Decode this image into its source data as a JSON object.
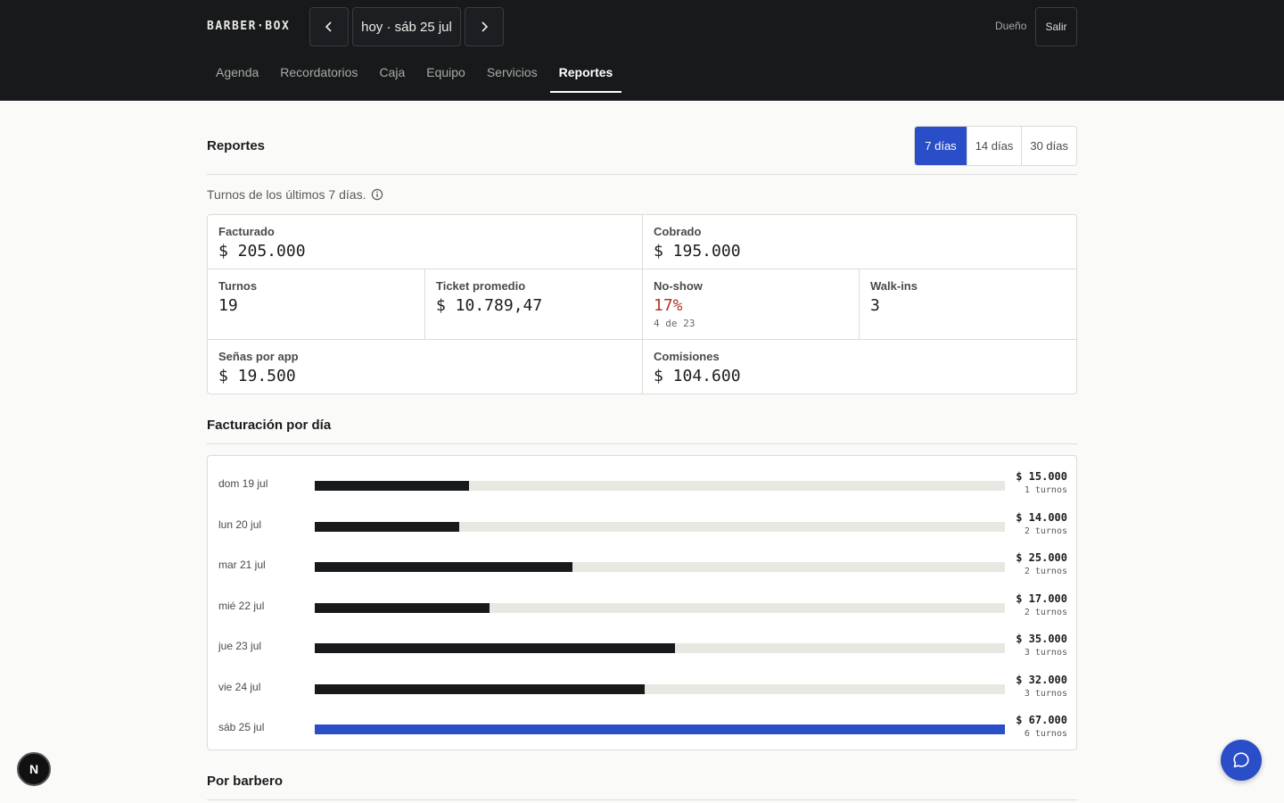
{
  "header": {
    "logo": "BARBER·BOX",
    "date_label": "hoy · sáb 25 jul",
    "role": "Dueño",
    "logout_label": "Salir",
    "tabs": [
      {
        "label": "Agenda",
        "active": false
      },
      {
        "label": "Recordatorios",
        "active": false
      },
      {
        "label": "Caja",
        "active": false
      },
      {
        "label": "Equipo",
        "active": false
      },
      {
        "label": "Servicios",
        "active": false
      },
      {
        "label": "Reportes",
        "active": true
      }
    ]
  },
  "page": {
    "title": "Reportes",
    "ranges": [
      {
        "label": "7 días",
        "active": true
      },
      {
        "label": "14 días",
        "active": false
      },
      {
        "label": "30 días",
        "active": false
      }
    ],
    "subtitle": "Turnos de los últimos 7 días."
  },
  "stats": {
    "facturado": {
      "label": "Facturado",
      "value": "$ 205.000"
    },
    "cobrado": {
      "label": "Cobrado",
      "value": "$ 195.000"
    },
    "turnos": {
      "label": "Turnos",
      "value": "19"
    },
    "ticket": {
      "label": "Ticket promedio",
      "value": "$ 10.789,47"
    },
    "noshow": {
      "label": "No-show",
      "value": "17%",
      "sub": "4 de 23"
    },
    "walkins": {
      "label": "Walk-ins",
      "value": "3"
    },
    "senas": {
      "label": "Señas por app",
      "value": "$ 19.500"
    },
    "comisiones": {
      "label": "Comisiones",
      "value": "$ 104.600"
    }
  },
  "sections": {
    "daily": "Facturación por día",
    "barber": "Por barbero"
  },
  "colors": {
    "accent": "#2a4dc8",
    "bar": "#18191b",
    "danger": "#b0372a"
  },
  "chart_data": {
    "type": "bar",
    "orientation": "horizontal",
    "categories": [
      "dom 19 jul",
      "lun 20 jul",
      "mar 21 jul",
      "mié 22 jul",
      "jue 23 jul",
      "vie 24 jul",
      "sáb 25 jul"
    ],
    "values": [
      15000,
      14000,
      25000,
      17000,
      35000,
      32000,
      67000
    ],
    "value_labels": [
      "$ 15.000",
      "$ 14.000",
      "$ 25.000",
      "$ 17.000",
      "$ 35.000",
      "$ 32.000",
      "$ 67.000"
    ],
    "count_labels": [
      "1 turnos",
      "2 turnos",
      "2 turnos",
      "2 turnos",
      "3 turnos",
      "3 turnos",
      "6 turnos"
    ],
    "highlight_index": 6,
    "xlim": [
      0,
      67000
    ]
  }
}
